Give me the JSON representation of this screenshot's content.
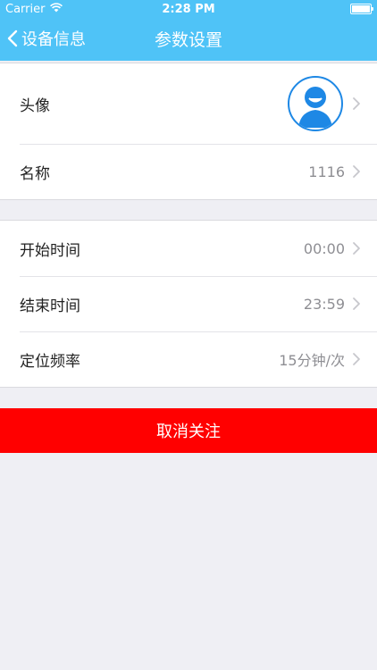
{
  "status_bar": {
    "carrier": "Carrier",
    "time": "2:28 PM"
  },
  "nav": {
    "back_label": "设备信息",
    "title": "参数设置"
  },
  "profile_section": {
    "avatar_label": "头像",
    "name_label": "名称",
    "name_value": "1116"
  },
  "settings_section": {
    "rows": [
      {
        "label": "开始时间",
        "value": "00:00"
      },
      {
        "label": "结束时间",
        "value": "23:59"
      },
      {
        "label": "定位频率",
        "value": "15分钟/次"
      }
    ]
  },
  "actions": {
    "unfollow_label": "取消关注"
  },
  "colors": {
    "nav_bg": "#4FC3F7",
    "accent_blue": "#1E88E5",
    "danger_red": "#FF0000",
    "page_bg": "#EFEFF4"
  }
}
